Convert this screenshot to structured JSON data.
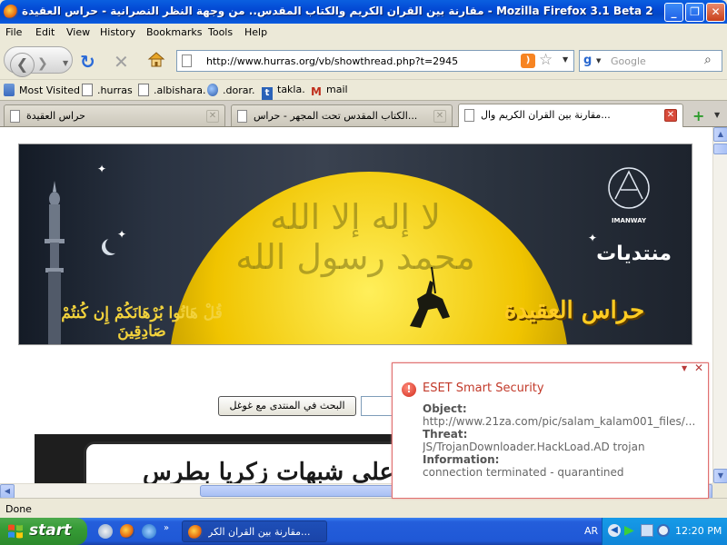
{
  "window": {
    "title": "مقارنة بين القران الكريم والكتاب المقدس.. من وجهة النظر النصرانية - حراس العقيدة - Mozilla Firefox 3.1 Beta 2",
    "minimize": "_",
    "maximize": "❐",
    "close": "✕"
  },
  "menu": {
    "file": "File",
    "edit": "Edit",
    "view": "View",
    "history": "History",
    "bookmarks": "Bookmarks",
    "tools": "Tools",
    "help": "Help"
  },
  "nav": {
    "url": "http://www.hurras.org/vb/showthread.php?t=2945",
    "search_placeholder": "Google",
    "search_engine": "g"
  },
  "bookmarks": {
    "most_visited": "Most Visited",
    "hurras": ".hurras",
    "albishara": ".albishara.",
    "dorar": ".dorar.",
    "takla": "takla.",
    "mail": "mail"
  },
  "tabs": [
    {
      "label": "حراس العقيدة"
    },
    {
      "label": "...الكتاب المقدس تحت المجهر - حراس"
    },
    {
      "label": "...مقارنة بين القران الكريم وال"
    }
  ],
  "banner": {
    "calligraphy": "لا إله إلا الله محمد رسول الله",
    "verse": "قُلْ هَاتُوا بُرْهَانَكُمْ إِن كُنتُمْ صَادِقِينَ",
    "forum_word": "منتديات",
    "forum_name": "حراس العقيدة",
    "logo_text": "IMANWAY"
  },
  "page": {
    "search_button": "البحث في المنتدى مع غوغل",
    "lower_banner_text": "متخصصة في الرد على شبهات زكريا بطرس"
  },
  "status": {
    "text": "Done"
  },
  "eset": {
    "title": "ESET Smart Security",
    "object_label": "Object:",
    "object_value": "http://www.21za.com/pic/salam_kalam001_files/...",
    "threat_label": "Threat:",
    "threat_value": "JS/TrojanDownloader.HackLoad.AD trojan",
    "info_label": "Information:",
    "info_value": "connection terminated - quarantined"
  },
  "taskbar": {
    "start": "start",
    "task_label": "...مقارنة بين القران الكر",
    "lang": "AR",
    "clock": "12:20 PM"
  },
  "colors": {
    "titlebar": "#0349d4",
    "eset_accent": "#c23a2a",
    "taskbar": "#245edb",
    "start": "#369b36"
  }
}
